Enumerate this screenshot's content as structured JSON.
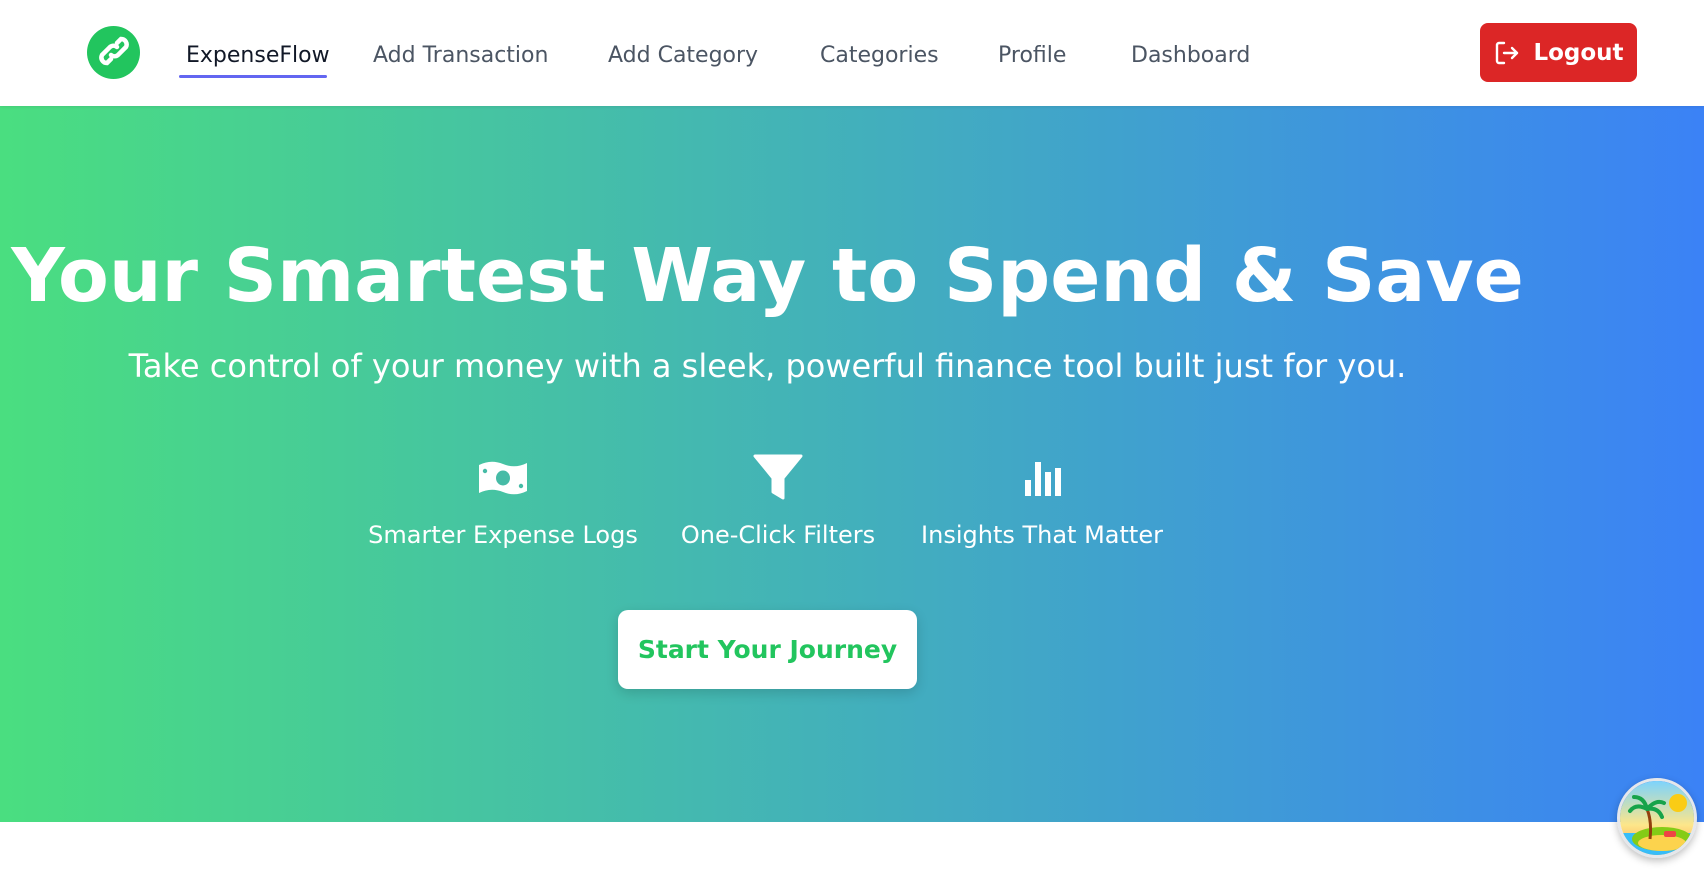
{
  "brand": {
    "logo_icon": "link-icon",
    "color": "#22c55e"
  },
  "nav": {
    "items": [
      {
        "label": "ExpenseFlow",
        "active": true
      },
      {
        "label": "Add Transaction"
      },
      {
        "label": "Add Category"
      },
      {
        "label": "Categories"
      },
      {
        "label": "Profile"
      },
      {
        "label": "Dashboard"
      }
    ],
    "active_underline_color": "#6366f1"
  },
  "logout": {
    "label": "Logout",
    "icon": "logout-icon",
    "color": "#dc2626"
  },
  "hero": {
    "title": "Your Smartest Way to Spend & Save",
    "subtitle": "Take control of your money with a sleek, powerful finance tool built just for you.",
    "gradient_start": "#4ade80",
    "gradient_end": "#3b82f6",
    "features": [
      {
        "label": "Smarter Expense Logs",
        "icon": "money-bill-icon"
      },
      {
        "label": "One-Click Filters",
        "icon": "filter-icon"
      },
      {
        "label": "Insights That Matter",
        "icon": "bar-chart-icon"
      }
    ],
    "cta_label": "Start Your Journey"
  },
  "avatar": {
    "icon": "beach-island-avatar"
  }
}
